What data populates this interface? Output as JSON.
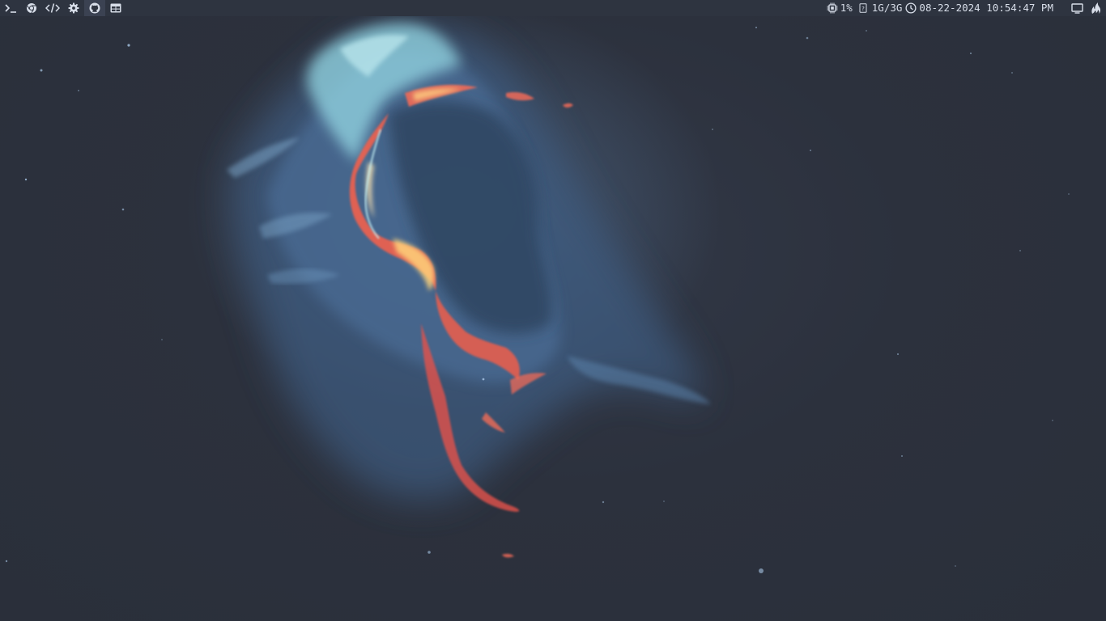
{
  "topbar": {
    "launchers": [
      {
        "name": "terminal",
        "icon": "terminal-icon",
        "active": false
      },
      {
        "name": "chrome",
        "icon": "chrome-icon",
        "active": false
      },
      {
        "name": "code-editor",
        "icon": "code-icon",
        "active": false
      },
      {
        "name": "settings",
        "icon": "gear-icon",
        "active": false
      },
      {
        "name": "github",
        "icon": "github-icon",
        "active": true
      },
      {
        "name": "layout",
        "icon": "layout-icon",
        "active": false
      }
    ],
    "cpu": {
      "icon": "cpu-icon",
      "value": "1%"
    },
    "memory": {
      "icon": "memory-icon",
      "value": "1G/3G"
    },
    "clock": {
      "icon": "clock-icon",
      "value": "08-22-2024 10:54:47 PM"
    },
    "tray": [
      {
        "icon": "display-icon"
      },
      {
        "icon": "flame-icon"
      }
    ]
  },
  "colors": {
    "bar_bg": "#2e3440",
    "bar_fg": "#d8dee9",
    "desktop_bg": "#2b303c",
    "nebula_blue": "#5b8fbf",
    "nebula_cyan": "#8fd3e0",
    "nebula_red": "#f0604e"
  },
  "wallpaper": {
    "description_icon": "nebula-wallpaper"
  }
}
